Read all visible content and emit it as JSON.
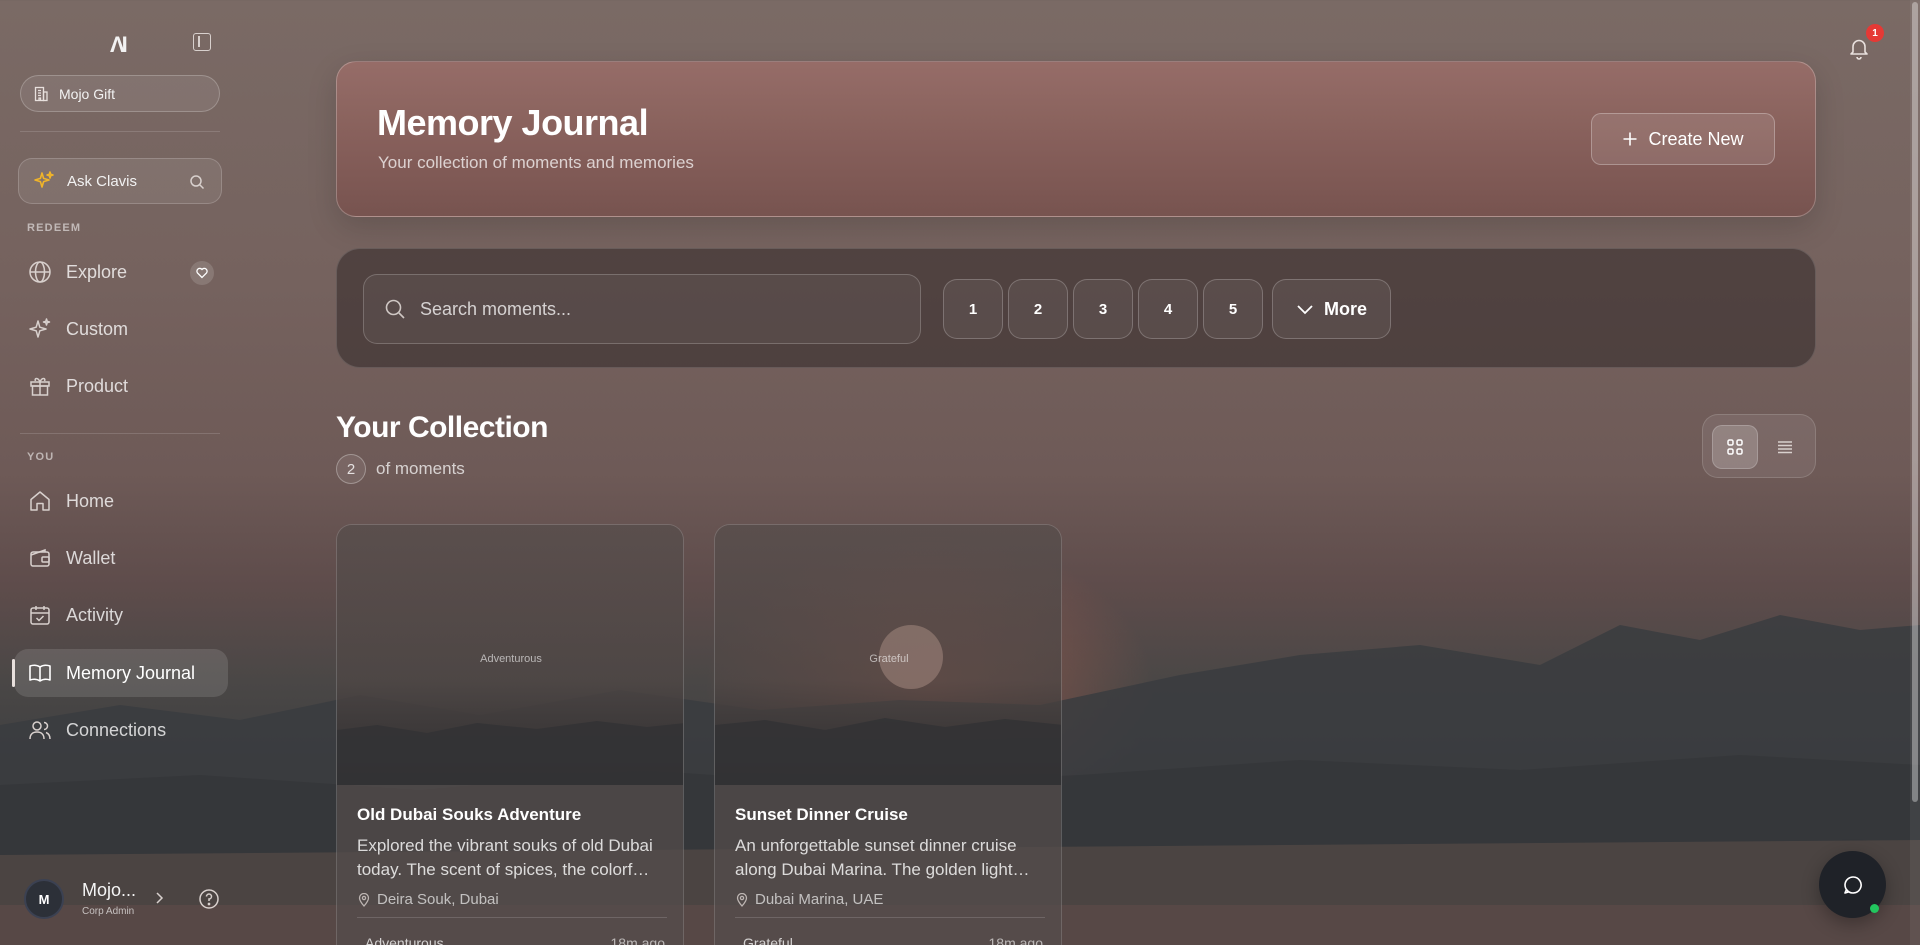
{
  "brand": {
    "logo_text": "ΛI"
  },
  "sidebar": {
    "org_name": "Mojo Gift",
    "ask_label": "Ask Clavis",
    "section_redeem": "REDEEM",
    "section_you": "YOU",
    "redeem_items": [
      {
        "label": "Explore",
        "icon": "globe-icon"
      },
      {
        "label": "Custom",
        "icon": "sparkles-icon"
      },
      {
        "label": "Product",
        "icon": "gift-icon"
      }
    ],
    "you_items": [
      {
        "label": "Home",
        "icon": "home-icon"
      },
      {
        "label": "Wallet",
        "icon": "wallet-icon"
      },
      {
        "label": "Activity",
        "icon": "calendar-check-icon"
      },
      {
        "label": "Memory Journal",
        "icon": "book-open-icon",
        "active": true
      },
      {
        "label": "Connections",
        "icon": "users-icon"
      }
    ],
    "user": {
      "initial": "M",
      "name": "Mojo...",
      "role": "Corp Admin"
    }
  },
  "header": {
    "title": "Memory Journal",
    "subtitle": "Your collection of moments and memories",
    "create_label": "Create New",
    "notification_count": "1"
  },
  "filters": {
    "search_placeholder": "Search moments...",
    "pages": [
      "1",
      "2",
      "3",
      "4",
      "5"
    ],
    "more_label": "More"
  },
  "collection": {
    "title": "Your Collection",
    "count": "2",
    "count_suffix": "of moments",
    "view_mode": "grid"
  },
  "cards": [
    {
      "tag": "Adventurous",
      "title": "Old Dubai Souks Adventure",
      "description": "Explored the vibrant souks of old Dubai today. The scent of spices, the colorf…",
      "location": "Deira Souk, Dubai",
      "mood": "Adventurous",
      "time": "18m ago"
    },
    {
      "tag": "Grateful",
      "title": "Sunset Dinner Cruise",
      "description": "An unforgettable sunset dinner cruise along Dubai Marina. The golden light…",
      "location": "Dubai Marina, UAE",
      "mood": "Grateful",
      "time": "18m ago"
    }
  ],
  "colors": {
    "accent": "#ffffff",
    "notification": "#e53935",
    "online": "#22c55e",
    "sparkle": "#f0b429"
  }
}
